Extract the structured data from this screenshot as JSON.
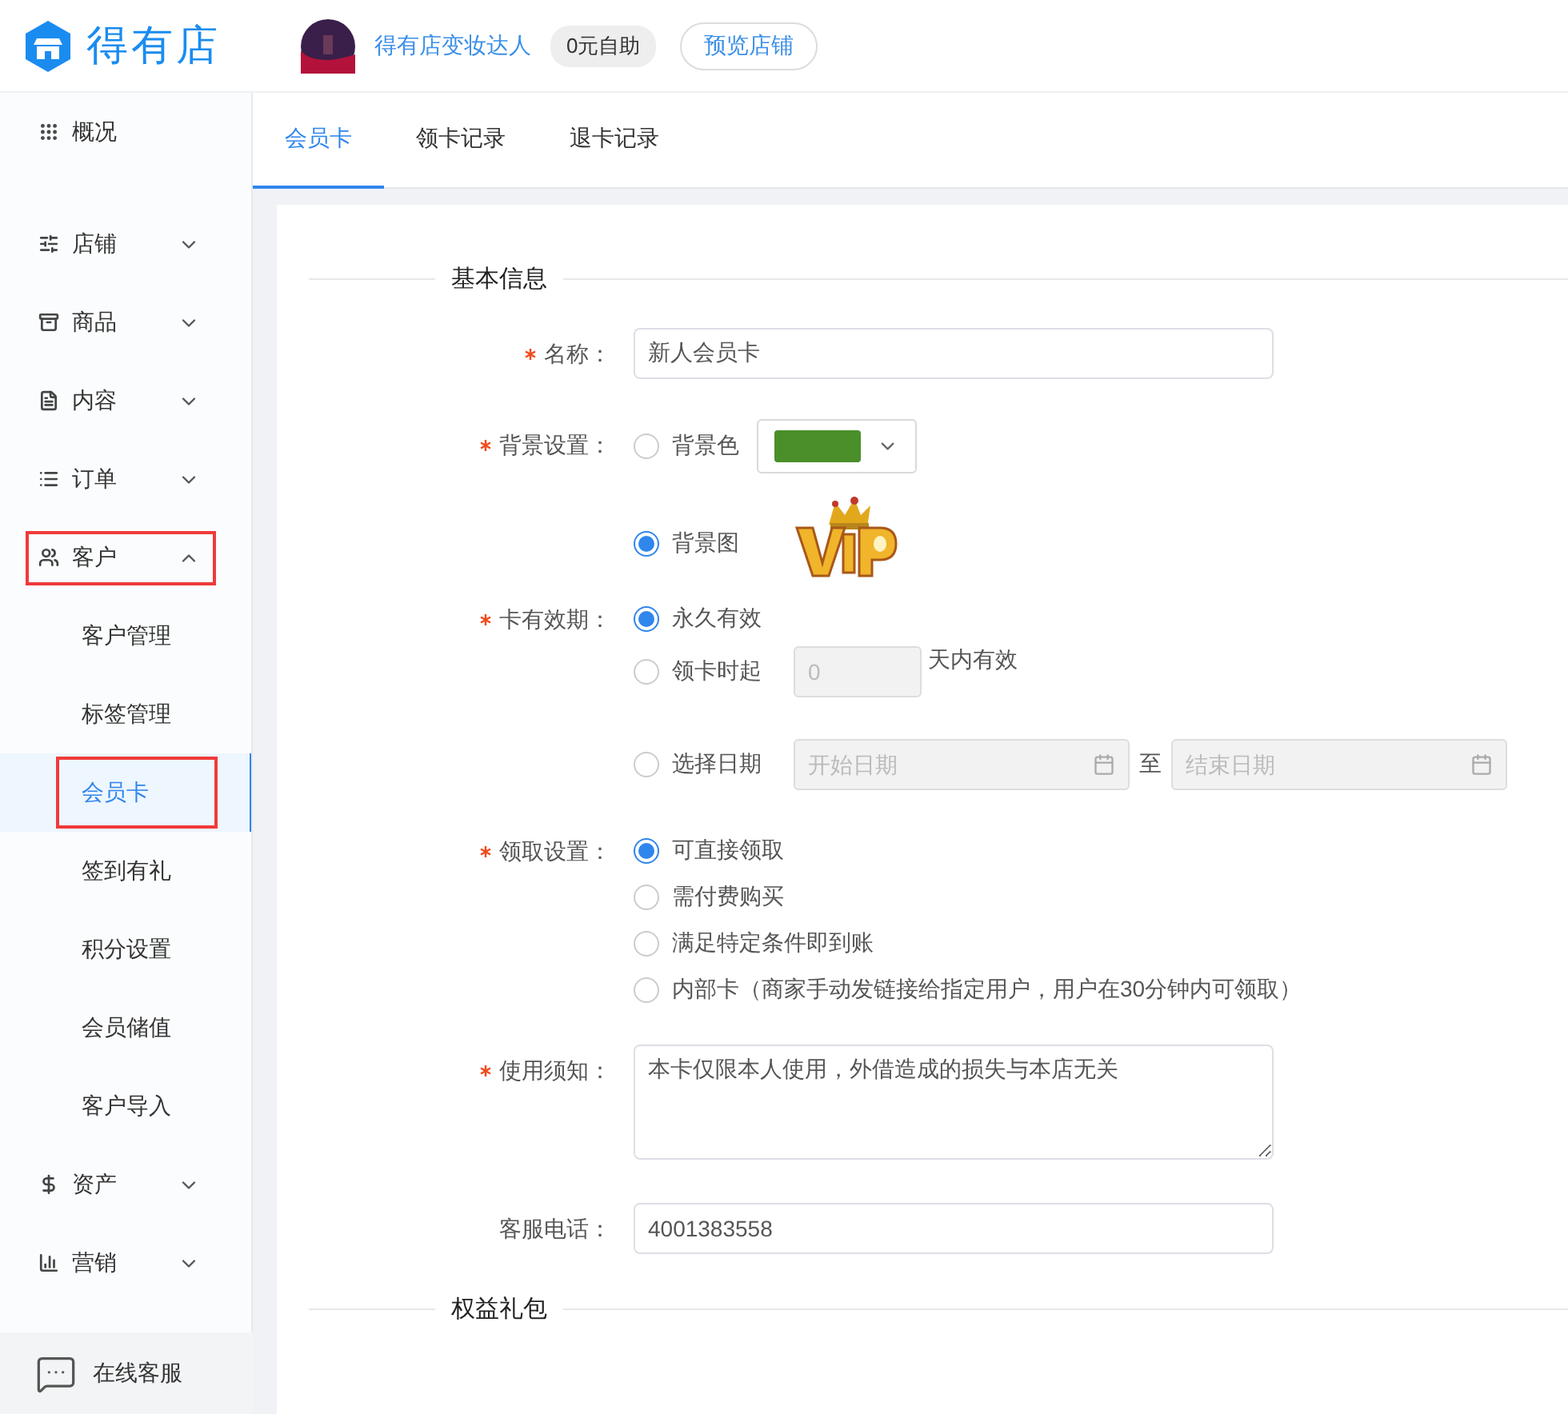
{
  "header": {
    "logo_text": "得有店",
    "shop_name": "得有店变妆达人",
    "plan_badge": "0元自助",
    "preview_button": "预览店铺"
  },
  "sidebar": {
    "items": [
      {
        "label": "概况",
        "selected": false,
        "highlighted": false
      },
      {
        "label": "店铺",
        "expanded": false,
        "selected": false,
        "highlighted": false
      },
      {
        "label": "商品",
        "expanded": false,
        "selected": false,
        "highlighted": false
      },
      {
        "label": "内容",
        "expanded": false,
        "selected": false,
        "highlighted": false
      },
      {
        "label": "订单",
        "expanded": false,
        "selected": false,
        "highlighted": false
      },
      {
        "label": "客户",
        "expanded": true,
        "selected": false,
        "highlighted": true,
        "children": [
          {
            "label": "客户管理",
            "selected": false,
            "highlighted": false
          },
          {
            "label": "标签管理",
            "selected": false,
            "highlighted": false
          },
          {
            "label": "会员卡",
            "selected": true,
            "highlighted": true
          },
          {
            "label": "签到有礼",
            "selected": false,
            "highlighted": false
          },
          {
            "label": "积分设置",
            "selected": false,
            "highlighted": false
          },
          {
            "label": "会员储值",
            "selected": false,
            "highlighted": false
          },
          {
            "label": "客户导入",
            "selected": false,
            "highlighted": false
          }
        ]
      },
      {
        "label": "资产",
        "expanded": false,
        "selected": false,
        "highlighted": false
      },
      {
        "label": "营销",
        "expanded": false,
        "selected": false,
        "highlighted": false
      }
    ],
    "support": "在线客服"
  },
  "tabs": [
    {
      "label": "会员卡",
      "selected": true
    },
    {
      "label": "领卡记录",
      "selected": false
    },
    {
      "label": "退卡记录",
      "selected": false
    }
  ],
  "form": {
    "section_title": "基本信息",
    "name": {
      "label": "名称：",
      "required": true,
      "value": "新人会员卡"
    },
    "background": {
      "label": "背景设置：",
      "required": true,
      "options": [
        {
          "kind": "color",
          "label": "背景色",
          "selected": false,
          "color": "#4a8f2a"
        },
        {
          "label": "背景图",
          "selected": true
        }
      ]
    },
    "validity": {
      "label": "卡有效期：",
      "required": true,
      "options": [
        {
          "kind": "plain",
          "label": "永久有效",
          "selected": true
        },
        {
          "kind": "days",
          "label": "领卡时起",
          "selected": false,
          "placeholder": "0",
          "suffix": "天内有效"
        },
        {
          "kind": "dates",
          "label": "选择日期",
          "selected": false,
          "start_placeholder": "开始日期",
          "separator": "至",
          "end_placeholder": "结束日期"
        }
      ]
    },
    "claim": {
      "label": "领取设置：",
      "required": true,
      "options": [
        {
          "label": "可直接领取",
          "selected": true
        },
        {
          "label": "需付费购买",
          "selected": false
        },
        {
          "label": "满足特定条件即到账",
          "selected": false
        },
        {
          "label": "内部卡（商家手动发链接给指定用户，用户在30分钟内可领取）",
          "selected": false
        }
      ]
    },
    "notice": {
      "label": "使用须知：",
      "required": true,
      "value": "本卡仅限本人使用，外借造成的损失与本店无关"
    },
    "phone": {
      "label": "客服电话：",
      "required": false,
      "value": "4001383558"
    },
    "next_section_title": "权益礼包"
  }
}
